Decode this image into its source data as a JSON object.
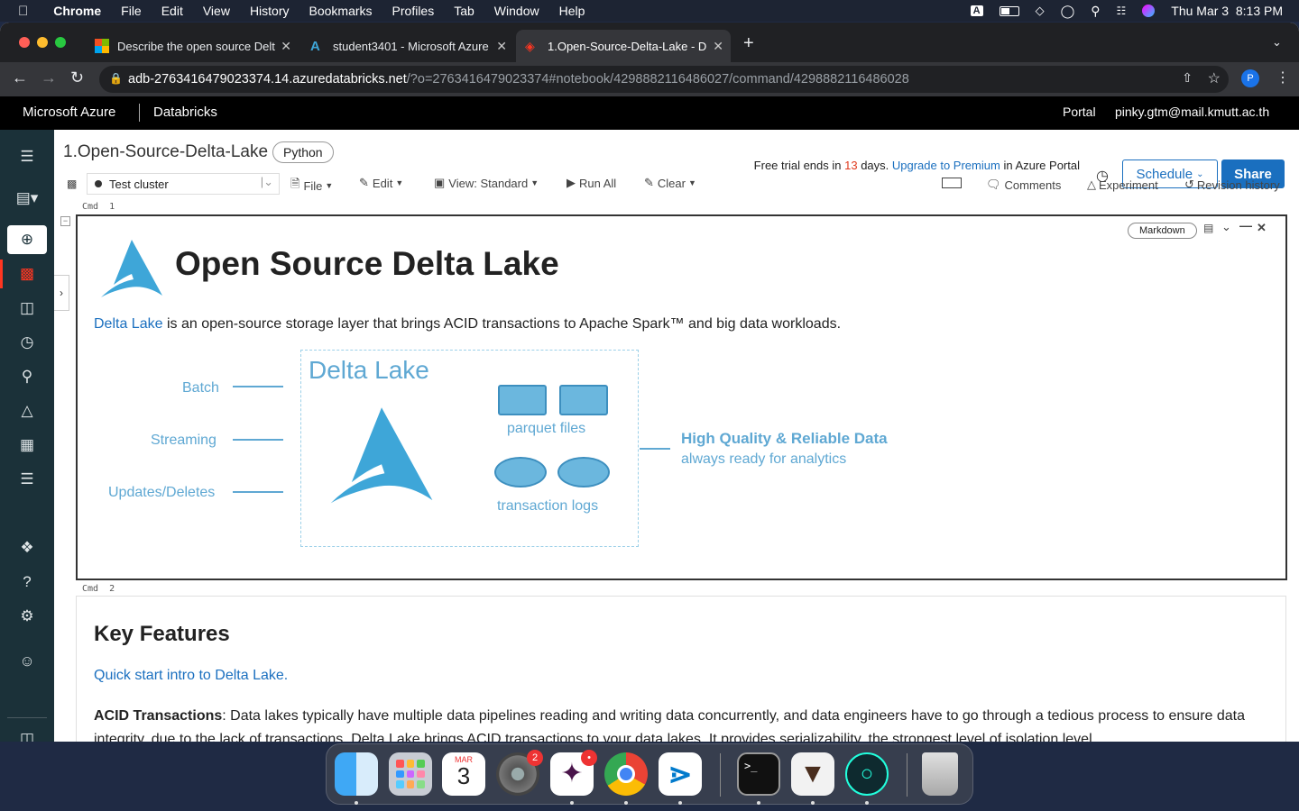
{
  "menubar": {
    "app": "Chrome",
    "items": [
      "File",
      "Edit",
      "View",
      "History",
      "Bookmarks",
      "Profiles",
      "Tab",
      "Window",
      "Help"
    ],
    "datetime": "Thu Mar 3  8:13 PM",
    "input_indicator": "A"
  },
  "browser": {
    "tabs": [
      {
        "label": "Describe the open source Delt",
        "favicon": "microsoft-icon"
      },
      {
        "label": "student3401 - Microsoft Azure",
        "favicon": "azure-icon"
      },
      {
        "label": "1.Open-Source-Delta-Lake - D",
        "favicon": "databricks-icon",
        "active": true
      }
    ],
    "url_host": "adb-2763416479023374.14.azuredatabricks.net",
    "url_path": "/?o=2763416479023374#notebook/4298882116486027/command/4298882116486028",
    "profile_initial": "P"
  },
  "azure_header": {
    "brand": "Microsoft Azure",
    "product": "Databricks",
    "portal": "Portal",
    "user": "pinky.gtm@mail.kmutt.ac.th"
  },
  "notebook": {
    "title": "1.Open-Source-Delta-Lake",
    "language": "Python",
    "trial_prefix": "Free trial ends in ",
    "trial_days": "13",
    "trial_mid": " days. ",
    "trial_link": "Upgrade to Premium",
    "trial_suffix": " in Azure Portal",
    "schedule": "Schedule",
    "share": "Share",
    "cluster": "Test cluster",
    "toolbar": {
      "file": "File",
      "edit": "Edit",
      "view": "View: Standard",
      "run_all": "Run All",
      "clear": "Clear",
      "comments": "Comments",
      "experiment": "Experiment",
      "revision": "Revision history"
    }
  },
  "cells": {
    "cmd1": {
      "label": "Cmd  1",
      "type_badge": "Markdown",
      "heading": "Open Source Delta Lake",
      "intro_link": "Delta Lake",
      "intro_rest": " is an open-source storage layer that brings ACID transactions to Apache Spark™ and big data workloads.",
      "diagram": {
        "inputs": [
          "Batch",
          "Streaming",
          "Updates/Deletes"
        ],
        "box_title": "Delta Lake",
        "parquet": "parquet files",
        "logs": "transaction logs",
        "output_title": "High Quality & Reliable Data",
        "output_sub": "always ready for analytics"
      }
    },
    "cmd2": {
      "label": "Cmd  2",
      "heading": "Key Features",
      "link": "Quick start intro to Delta Lake.",
      "acid_title": "ACID Transactions",
      "acid_text": ": Data lakes typically have multiple data pipelines reading and writing data concurrently, and data engineers have to go through a tedious process to ensure data integrity, due to the lack of transactions. Delta Lake brings ACID transactions to your data lakes. It provides serializability, the strongest level of isolation level."
    }
  },
  "dock": {
    "apps": [
      "finder-icon",
      "launchpad-icon",
      "calendar-icon",
      "system-preferences-icon",
      "slack-icon",
      "chrome-icon",
      "vscode-icon",
      "terminal-icon",
      "gitbash-icon",
      "gitkraken-icon",
      "trash-icon"
    ],
    "calendar_month": "MAR",
    "calendar_day": "3",
    "sysprefs_badge": "2",
    "slack_badge": "•"
  },
  "colors": {
    "accent_blue": "#1a6fbf",
    "databricks_sidebar": "#1b3139",
    "delta_blue": "#3ea6d8",
    "trial_red": "#e03a1e"
  }
}
